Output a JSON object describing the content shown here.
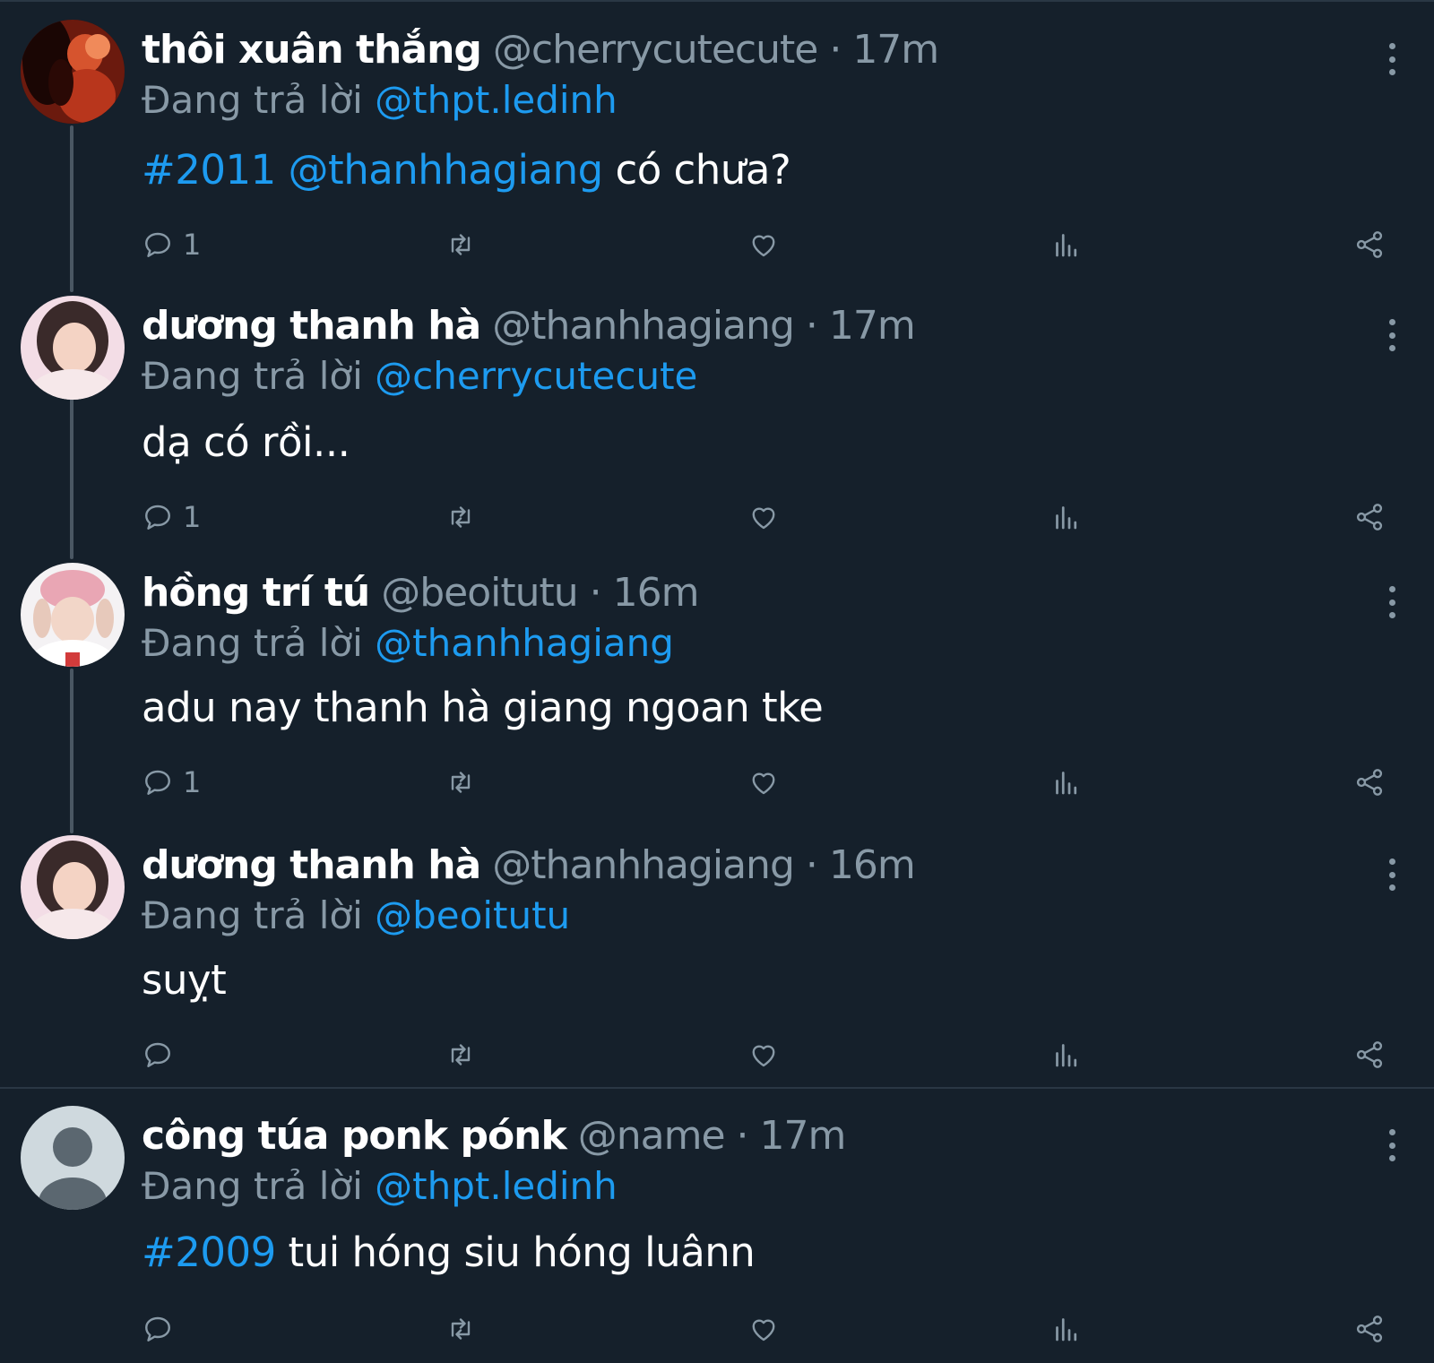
{
  "colors": {
    "background": "#15202b",
    "accent": "#1d9bf0",
    "muted": "#8899a6"
  },
  "tweets": [
    {
      "name": "thôi xuân thắng",
      "handle": "@cherrycutecute",
      "sep": "·",
      "time": "17m",
      "reply_prefix": "Đang trả lời",
      "reply_to": "@thpt.ledinh",
      "tag": "#2011",
      "mention": "@thanhhagiang",
      "text": "có chưa?",
      "reply_count": "1",
      "avatar": "photo-avatar-red"
    },
    {
      "name": "dương thanh hà",
      "handle": "@thanhhagiang",
      "sep": "·",
      "time": "17m",
      "reply_prefix": "Đang trả lời",
      "reply_to": "@cherrycutecute",
      "text": "dạ có rồi...",
      "reply_count": "1",
      "avatar": "photo-avatar-pink"
    },
    {
      "name": "hồng trí tú",
      "handle": "@beoitutu",
      "sep": "·",
      "time": "16m",
      "reply_prefix": "Đang trả lời",
      "reply_to": "@thanhhagiang",
      "text": "adu nay thanh hà giang ngoan tke",
      "reply_count": "1",
      "avatar": "photo-avatar-hat"
    },
    {
      "name": "dương thanh hà",
      "handle": "@thanhhagiang",
      "sep": "·",
      "time": "16m",
      "reply_prefix": "Đang trả lời",
      "reply_to": "@beoitutu",
      "text": "suỵt",
      "reply_count": "",
      "avatar": "photo-avatar-pink"
    },
    {
      "name": "công túa ponk pónk",
      "handle": "@name",
      "sep": "·",
      "time": "17m",
      "reply_prefix": "Đang trả lời",
      "reply_to": "@thpt.ledinh",
      "tag": "#2009",
      "text": "tui hóng siu hóng luânn",
      "reply_count": "",
      "avatar": "default-avatar"
    }
  ],
  "icons": [
    "reply-icon",
    "retweet-icon",
    "like-icon",
    "analytics-icon",
    "share-icon",
    "more-icon"
  ]
}
